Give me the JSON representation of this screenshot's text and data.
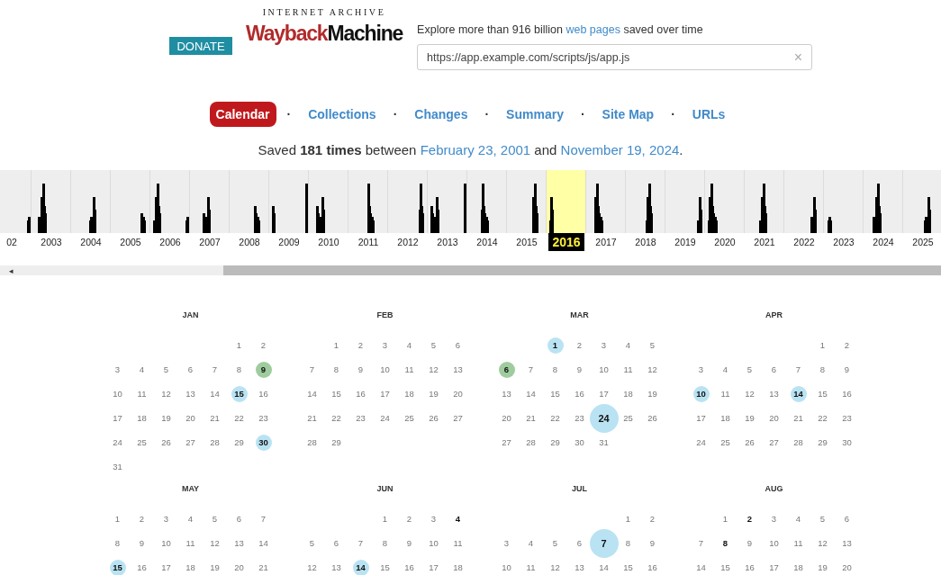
{
  "header": {
    "donate": "DONATE",
    "logo_top": "INTERNET ARCHIVE",
    "logo_red": "Wayback",
    "logo_black": "Machine",
    "tagline_before": "Explore more than 916 billion ",
    "tagline_link": "web pages",
    "tagline_after": " saved over time",
    "url_value": "https://app.example.com/scripts/js/app.js",
    "clear": "×"
  },
  "nav": [
    {
      "label": "Calendar",
      "selected": true
    },
    {
      "label": "Collections",
      "selected": false
    },
    {
      "label": "Changes",
      "selected": false
    },
    {
      "label": "Summary",
      "selected": false
    },
    {
      "label": "Site Map",
      "selected": false
    },
    {
      "label": "URLs",
      "selected": false
    }
  ],
  "nav_separator": "·",
  "summary": {
    "before": "Saved ",
    "count": "181 times",
    "middle": " between ",
    "first": "February 23, 2001",
    "and": " and ",
    "last": "November 19, 2024",
    "end": "."
  },
  "years": [
    {
      "label": "02",
      "selected": false
    },
    {
      "label": "2003",
      "selected": false
    },
    {
      "label": "2004",
      "selected": false
    },
    {
      "label": "2005",
      "selected": false
    },
    {
      "label": "2006",
      "selected": false
    },
    {
      "label": "2007",
      "selected": false
    },
    {
      "label": "2008",
      "selected": false
    },
    {
      "label": "2009",
      "selected": false
    },
    {
      "label": "2010",
      "selected": false
    },
    {
      "label": "2011",
      "selected": false
    },
    {
      "label": "2012",
      "selected": false
    },
    {
      "label": "2013",
      "selected": false
    },
    {
      "label": "2014",
      "selected": false
    },
    {
      "label": "2015",
      "selected": false
    },
    {
      "label": "2016",
      "selected": true
    },
    {
      "label": "2017",
      "selected": false
    },
    {
      "label": "2018",
      "selected": false
    },
    {
      "label": "2019",
      "selected": false
    },
    {
      "label": "2020",
      "selected": false
    },
    {
      "label": "2021",
      "selected": false
    },
    {
      "label": "2022",
      "selected": false
    },
    {
      "label": "2023",
      "selected": false
    },
    {
      "label": "2024",
      "selected": false
    },
    {
      "label": "2025",
      "selected": false
    }
  ],
  "scroll_arrow": "◂",
  "months": [
    {
      "name": "JAN",
      "weeks": [
        {
          "kind": "lead",
          "days": [
            "1",
            "2"
          ]
        },
        {
          "kind": "full",
          "days": [
            "3",
            "4",
            "5",
            "6",
            "7",
            "8",
            {
              "day": "9",
              "kind": "green"
            }
          ]
        },
        {
          "kind": "full",
          "days": [
            "10",
            "11",
            "12",
            "13",
            "14",
            {
              "day": "15",
              "kind": "blue"
            },
            "16"
          ]
        },
        {
          "kind": "full",
          "days": [
            "17",
            "18",
            "19",
            "20",
            "21",
            "22",
            "23"
          ]
        },
        {
          "kind": "full",
          "days": [
            "24",
            "25",
            "26",
            "27",
            "28",
            "29",
            {
              "day": "30",
              "kind": "blue"
            }
          ]
        },
        {
          "kind": "full",
          "days": [
            "31"
          ]
        }
      ]
    },
    {
      "name": "FEB",
      "weeks": [
        {
          "kind": "lead",
          "days": [
            "1",
            "2",
            "3",
            "4",
            "5",
            "6"
          ]
        },
        {
          "kind": "full",
          "days": [
            "7",
            "8",
            "9",
            "10",
            "11",
            "12",
            "13"
          ]
        },
        {
          "kind": "full",
          "days": [
            "14",
            "15",
            "16",
            "17",
            "18",
            "19",
            "20"
          ]
        },
        {
          "kind": "full",
          "days": [
            "21",
            "22",
            "23",
            "24",
            "25",
            "26",
            "27"
          ]
        },
        {
          "kind": "full",
          "days": [
            "28",
            "29"
          ]
        }
      ]
    },
    {
      "name": "MAR",
      "weeks": [
        {
          "kind": "lead",
          "days": [
            {
              "day": "1",
              "kind": "blue"
            },
            "2",
            "3",
            "4",
            "5"
          ]
        },
        {
          "kind": "full",
          "days": [
            {
              "day": "6",
              "kind": "green"
            },
            "7",
            "8",
            "9",
            "10",
            "11",
            "12"
          ]
        },
        {
          "kind": "full",
          "days": [
            "13",
            "14",
            "15",
            "16",
            "17",
            "18",
            "19"
          ]
        },
        {
          "kind": "full",
          "days": [
            "20",
            "21",
            "22",
            "23",
            {
              "day": "24",
              "kind": "blue-large"
            },
            "25",
            "26"
          ]
        },
        {
          "kind": "full",
          "days": [
            "27",
            "28",
            "29",
            "30",
            "31"
          ]
        }
      ]
    },
    {
      "name": "APR",
      "weeks": [
        {
          "kind": "lead",
          "days": [
            "1",
            "2"
          ]
        },
        {
          "kind": "full",
          "days": [
            "3",
            "4",
            "5",
            "6",
            "7",
            "8",
            "9"
          ]
        },
        {
          "kind": "full",
          "days": [
            {
              "day": "10",
              "kind": "blue"
            },
            "11",
            "12",
            "13",
            {
              "day": "14",
              "kind": "blue"
            },
            "15",
            "16"
          ]
        },
        {
          "kind": "full",
          "days": [
            "17",
            "18",
            "19",
            "20",
            "21",
            "22",
            "23"
          ]
        },
        {
          "kind": "full",
          "days": [
            "24",
            "25",
            "26",
            "27",
            "28",
            "29",
            "30"
          ]
        }
      ]
    },
    {
      "name": "MAY",
      "weeks": [
        {
          "kind": "full",
          "days": [
            "1",
            "2",
            "3",
            "4",
            "5",
            "6",
            "7"
          ]
        },
        {
          "kind": "full",
          "days": [
            "8",
            "9",
            "10",
            "11",
            "12",
            "13",
            "14"
          ]
        },
        {
          "kind": "full",
          "days": [
            {
              "day": "15",
              "kind": "blue"
            },
            "16",
            "17",
            "18",
            "19",
            "20",
            "21"
          ]
        }
      ]
    },
    {
      "name": "JUN",
      "weeks": [
        {
          "kind": "lead",
          "days": [
            "1",
            "2",
            "3",
            {
              "day": "4",
              "kind": "bold"
            }
          ]
        },
        {
          "kind": "full",
          "days": [
            "5",
            "6",
            "7",
            "8",
            "9",
            "10",
            "11"
          ]
        },
        {
          "kind": "full",
          "days": [
            "12",
            "13",
            {
              "day": "14",
              "kind": "blue"
            },
            "15",
            "16",
            "17",
            "18"
          ]
        }
      ]
    },
    {
      "name": "JUL",
      "weeks": [
        {
          "kind": "lead",
          "days": [
            "1",
            "2"
          ]
        },
        {
          "kind": "full",
          "days": [
            "3",
            "4",
            "5",
            "6",
            {
              "day": "7",
              "kind": "blue-large"
            },
            "8",
            "9"
          ]
        },
        {
          "kind": "full",
          "days": [
            "10",
            "11",
            "12",
            "13",
            "14",
            "15",
            "16"
          ]
        }
      ]
    },
    {
      "name": "AUG",
      "weeks": [
        {
          "kind": "lead",
          "days": [
            "1",
            {
              "day": "2",
              "kind": "bold"
            },
            "3",
            "4",
            "5",
            "6"
          ]
        },
        {
          "kind": "full",
          "days": [
            "7",
            {
              "day": "8",
              "kind": "bold"
            },
            "9",
            "10",
            "11",
            "12",
            "13"
          ]
        },
        {
          "kind": "full",
          "days": [
            "14",
            "15",
            "16",
            "17",
            "18",
            "19",
            "20"
          ]
        }
      ]
    }
  ]
}
